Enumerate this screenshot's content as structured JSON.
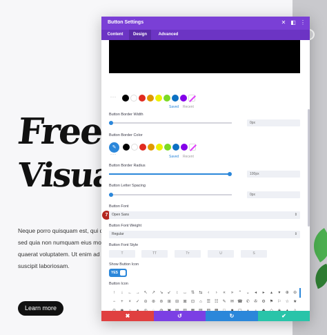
{
  "background": {
    "hero_line_1": "Freelar",
    "hero_line_2": "Visual",
    "paragraph": [
      "Neque porro quisquam est, qui d",
      "sed quia non numquam eius mo",
      "quaerat voluptatem. Ut enim ad",
      "suscipit laboriosam."
    ],
    "learn_more_label": "Learn more"
  },
  "modal": {
    "title": "Button Settings",
    "header_icons": [
      "close-icon",
      "expand-icon",
      "menu-icon"
    ],
    "tabs": [
      {
        "label": "Content",
        "active": false
      },
      {
        "label": "Design",
        "active": true
      },
      {
        "label": "Advanced",
        "active": false
      }
    ],
    "colors": {
      "purple_header": "#7a3fd6",
      "accent_blue": "#2b87da",
      "footer_cancel": "#e04040",
      "footer_undo": "#7b3fe4",
      "footer_redo": "#2b87da",
      "footer_save": "#29c4a9"
    },
    "top_palette": {
      "swatches": [
        "#000000",
        "#ffffff",
        "#e02b20",
        "#e09900",
        "#edf000",
        "#7cda24",
        "#0c71c3",
        "#8300e9"
      ],
      "saved_label": "Saved",
      "recent_label": "Recent"
    },
    "border_width": {
      "label": "Button Border Width",
      "value": "0px",
      "level": 0
    },
    "border_color": {
      "label": "Button Border Color",
      "swatches": [
        "#000000",
        "#ffffff",
        "#e02b20",
        "#e09900",
        "#edf000",
        "#7cda24",
        "#0c71c3",
        "#8300e9"
      ],
      "saved_label": "Saved",
      "recent_label": "Recent"
    },
    "border_radius": {
      "label": "Button Border Radius",
      "value": "100px",
      "level": 1.0
    },
    "letter_spacing": {
      "label": "Button Letter Spacing",
      "value": "0px",
      "level": 0
    },
    "font": {
      "label": "Button Font",
      "value": "Open Sans",
      "marker": "7"
    },
    "font_weight": {
      "label": "Button Font Weight",
      "value": "Regular"
    },
    "font_style": {
      "label": "Button Font Style",
      "buttons": [
        "T",
        "TT",
        "Tт",
        "U",
        "S"
      ]
    },
    "show_icon": {
      "label": "Show Button Icon",
      "toggle_label": "YES"
    },
    "button_icon": {
      "label": "Button Icon",
      "rows": [
        [
          "↑",
          "↓",
          "←",
          "→",
          "↖",
          "↗",
          "↘",
          "↙",
          "↕",
          "↔",
          "⇅",
          "⇆",
          "‹",
          "›",
          "«",
          "»",
          "⌃",
          "⌄",
          "◂",
          "▸",
          "▴",
          "▾",
          "⊕",
          "⊖",
          "⊗",
          "⊙",
          "⊘",
          "⊚",
          "✕",
          "✚"
        ],
        [
          "−",
          "+",
          "×",
          "✓",
          "⊝",
          "⊛",
          "⊜",
          "⊞",
          "⊟",
          "⊠",
          "⊡",
          "⌂",
          "☰",
          "☷",
          "✎",
          "✉",
          "☎",
          "✆",
          "✇",
          "⚙",
          "⚑",
          "⚐",
          "☆",
          "★",
          "♡",
          "♥",
          "☀",
          "☁",
          "⚡",
          "⌖"
        ],
        [
          "⊙",
          "◉",
          "○",
          "●",
          "◎",
          "◌",
          "◍",
          "▣",
          "▤",
          "▥",
          "▦",
          "▧",
          "▨",
          "▩",
          "□",
          "■",
          "▢",
          "▪",
          "▫",
          "◆",
          "◇",
          "◈",
          "▲",
          "△",
          "▼",
          "▽",
          "◀",
          "▶",
          "◐",
          "◑"
        ]
      ]
    },
    "footer": [
      {
        "icon": "close-icon",
        "glyph": "✖"
      },
      {
        "icon": "undo-icon",
        "glyph": "↺"
      },
      {
        "icon": "redo-icon",
        "glyph": "↻"
      },
      {
        "icon": "check-icon",
        "glyph": "✔"
      }
    ]
  }
}
